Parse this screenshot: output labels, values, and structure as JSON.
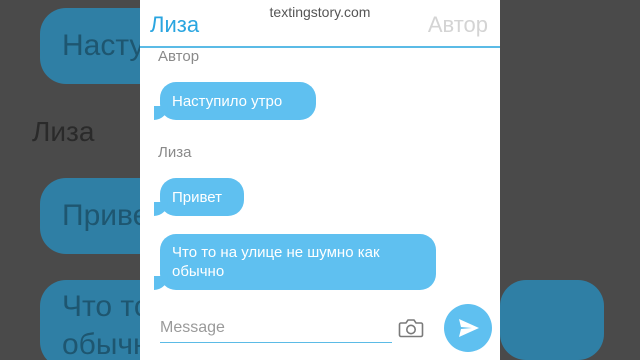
{
  "header": {
    "left_contact": "Лиза",
    "right_contact": "Автор",
    "watermark": "textingstory.com"
  },
  "messages": [
    {
      "sender": "Автор",
      "text": "Наступило утро"
    },
    {
      "sender": "Лиза",
      "text": "Привет"
    },
    {
      "sender": "",
      "text": "Что то на улице не шумно как обычно"
    }
  ],
  "composer": {
    "placeholder": "Message",
    "camera_icon": "camera-icon",
    "send_icon": "send-icon"
  },
  "background": {
    "bubble_1": "Насту",
    "label": "Лиза",
    "bubble_2": "Приве",
    "bubble_3a": "Что то",
    "bubble_3b": "обычн"
  },
  "colors": {
    "accent": "#5fc0f0",
    "header_accent": "#2aa5e0",
    "inactive_name": "#d4d4d4"
  }
}
